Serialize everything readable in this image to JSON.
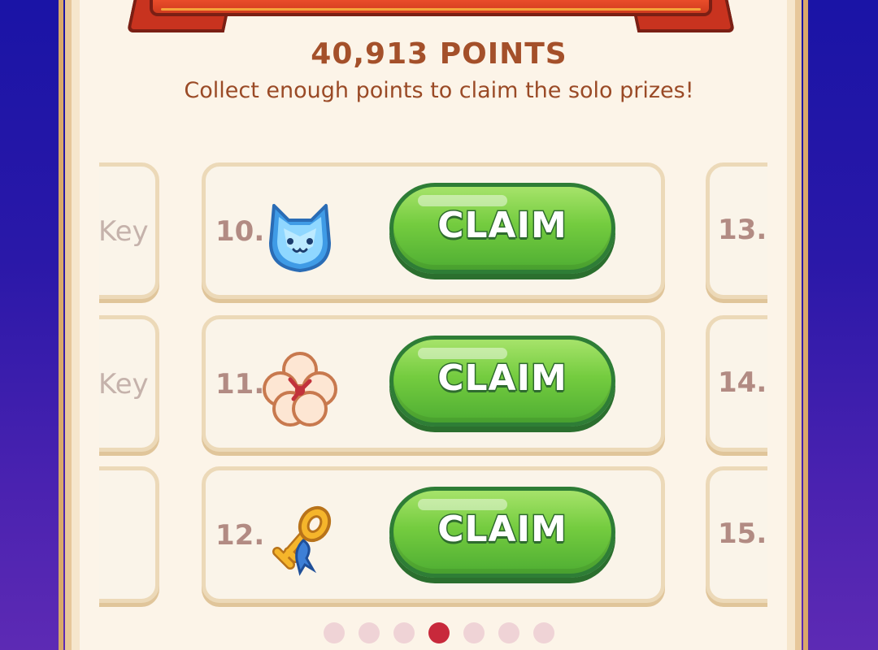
{
  "header": {
    "points_label": "40,913 POINTS",
    "subtitle": "Collect enough points to claim the solo prizes!"
  },
  "prizes": [
    {
      "rank": "10.",
      "icon": "blue-cat-gem-icon",
      "button_label": "CLAIM"
    },
    {
      "rank": "11.",
      "icon": "cotton-flower-icon",
      "button_label": "CLAIM"
    },
    {
      "rank": "12.",
      "icon": "golden-key-icon",
      "button_label": "CLAIM"
    }
  ],
  "left_column": {
    "items": [
      {
        "text": "Key"
      },
      {
        "text": "Key"
      },
      {
        "text": ""
      }
    ]
  },
  "right_column": {
    "items": [
      {
        "rank": "13."
      },
      {
        "rank": "14."
      },
      {
        "rank": "15."
      }
    ]
  },
  "pagination": {
    "total_pages": 7,
    "current_page": 4
  },
  "colors": {
    "claim_button": "#74cc3f",
    "active_dot": "#c8293b",
    "inactive_dot": "#efd3d6",
    "ribbon": "#e94d2a",
    "points_text": "#a4502a"
  }
}
